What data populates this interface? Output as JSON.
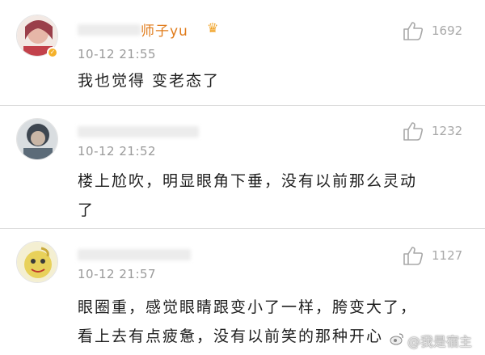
{
  "comments": [
    {
      "username": "师子yu",
      "time": "10-12 21:55",
      "likes": "1692",
      "text_lines": [
        "我也觉得 变老态了"
      ]
    },
    {
      "username": "",
      "time": "10-12 21:52",
      "likes": "1232",
      "text_lines": [
        "楼上尬吹，明显眼角下垂，没有以前那么灵动",
        "了"
      ]
    },
    {
      "username": "",
      "time": "10-12 21:57",
      "likes": "1127",
      "text_lines": [
        "眼圈重，感觉眼睛跟变小了一样，胯变大了，",
        "看上去有点疲惫，没有以前笑的那种开心"
      ]
    }
  ],
  "watermark": {
    "text": "@我是宿主",
    "icon": "weibo-icon"
  },
  "colors": {
    "username": "#e07b1a",
    "time": "#9a9a9a",
    "like": "#a8a8a8",
    "vip_badge": "#f5b12a"
  }
}
